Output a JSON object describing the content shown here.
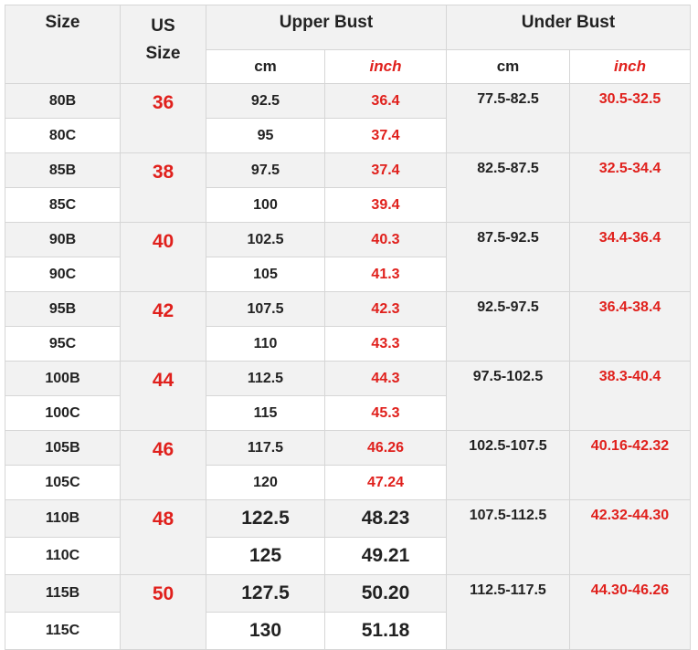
{
  "headers": {
    "size": "Size",
    "us_size_line1": "US",
    "us_size_line2": "Size",
    "upper_bust": "Upper Bust",
    "under_bust": "Under Bust",
    "cm": "cm",
    "inch": "inch"
  },
  "groups": [
    {
      "us": "36",
      "under_cm": "77.5-82.5",
      "under_inch": "30.5-32.5",
      "rows": [
        {
          "size": "80B",
          "cm": "92.5",
          "inch": "36.4"
        },
        {
          "size": "80C",
          "cm": "95",
          "inch": "37.4"
        }
      ]
    },
    {
      "us": "38",
      "under_cm": "82.5-87.5",
      "under_inch": "32.5-34.4",
      "rows": [
        {
          "size": "85B",
          "cm": "97.5",
          "inch": "37.4"
        },
        {
          "size": "85C",
          "cm": "100",
          "inch": "39.4"
        }
      ]
    },
    {
      "us": "40",
      "under_cm": "87.5-92.5",
      "under_inch": "34.4-36.4",
      "rows": [
        {
          "size": "90B",
          "cm": "102.5",
          "inch": "40.3"
        },
        {
          "size": "90C",
          "cm": "105",
          "inch": "41.3"
        }
      ]
    },
    {
      "us": "42",
      "under_cm": "92.5-97.5",
      "under_inch": "36.4-38.4",
      "rows": [
        {
          "size": "95B",
          "cm": "107.5",
          "inch": "42.3"
        },
        {
          "size": "95C",
          "cm": "110",
          "inch": "43.3"
        }
      ]
    },
    {
      "us": "44",
      "under_cm": "97.5-102.5",
      "under_inch": "38.3-40.4",
      "rows": [
        {
          "size": "100B",
          "cm": "112.5",
          "inch": "44.3"
        },
        {
          "size": "100C",
          "cm": "115",
          "inch": "45.3"
        }
      ]
    },
    {
      "us": "46",
      "under_cm": "102.5-107.5",
      "under_inch": "40.16-42.32",
      "rows": [
        {
          "size": "105B",
          "cm": "117.5",
          "inch": "46.26"
        },
        {
          "size": "105C",
          "cm": "120",
          "inch": "47.24"
        }
      ]
    },
    {
      "us": "48",
      "under_cm": "107.5-112.5",
      "under_inch": "42.32-44.30",
      "rows": [
        {
          "size": "110B",
          "cm": "122.5",
          "inch": "48.23"
        },
        {
          "size": "110C",
          "cm": "125",
          "inch": "49.21"
        }
      ]
    },
    {
      "us": "50",
      "under_cm": "112.5-117.5",
      "under_inch": "44.30-46.26",
      "rows": [
        {
          "size": "115B",
          "cm": "127.5",
          "inch": "50.20"
        },
        {
          "size": "115C",
          "cm": "130",
          "inch": "51.18"
        }
      ]
    }
  ],
  "colors": {
    "accent_red": "#e0201c",
    "header_gray": "#f2f2f2",
    "border": "#d6d6d6"
  }
}
